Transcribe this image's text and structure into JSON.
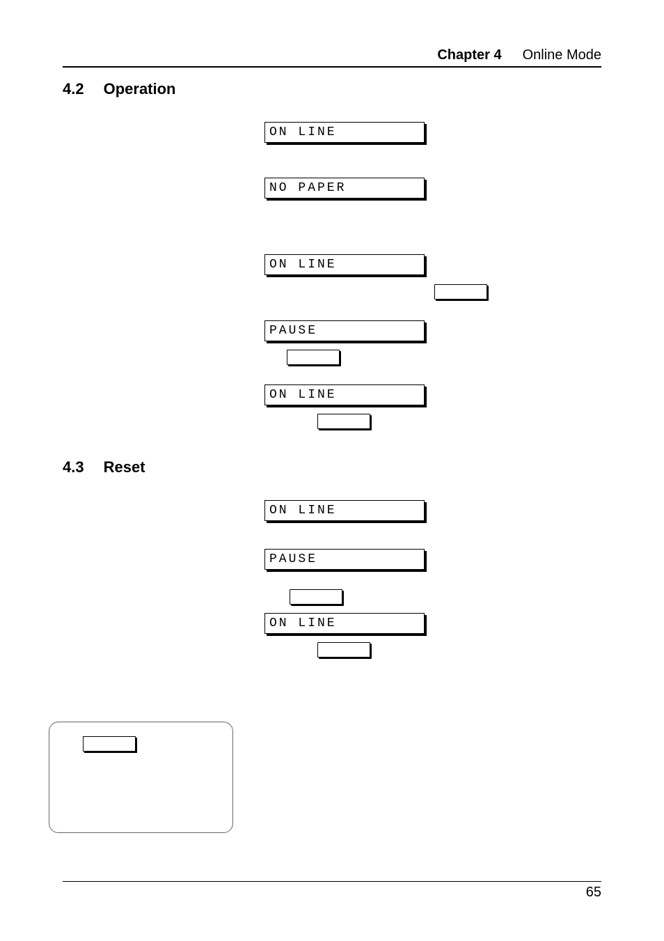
{
  "header": {
    "chapter_label": "Chapter 4",
    "chapter_title": "Online Mode"
  },
  "sections": {
    "operation": {
      "num": "4.2",
      "title": "Operation"
    },
    "reset": {
      "num": "4.3",
      "title": "Reset"
    }
  },
  "operation_displays": {
    "d1": "ON LINE",
    "d2": "NO PAPER",
    "d3": "ON LINE",
    "d4": "PAUSE",
    "d5": "ON LINE"
  },
  "reset_displays": {
    "d1": "ON LINE",
    "d2": "PAUSE",
    "d3": "ON LINE"
  },
  "footer": {
    "page": "65"
  }
}
